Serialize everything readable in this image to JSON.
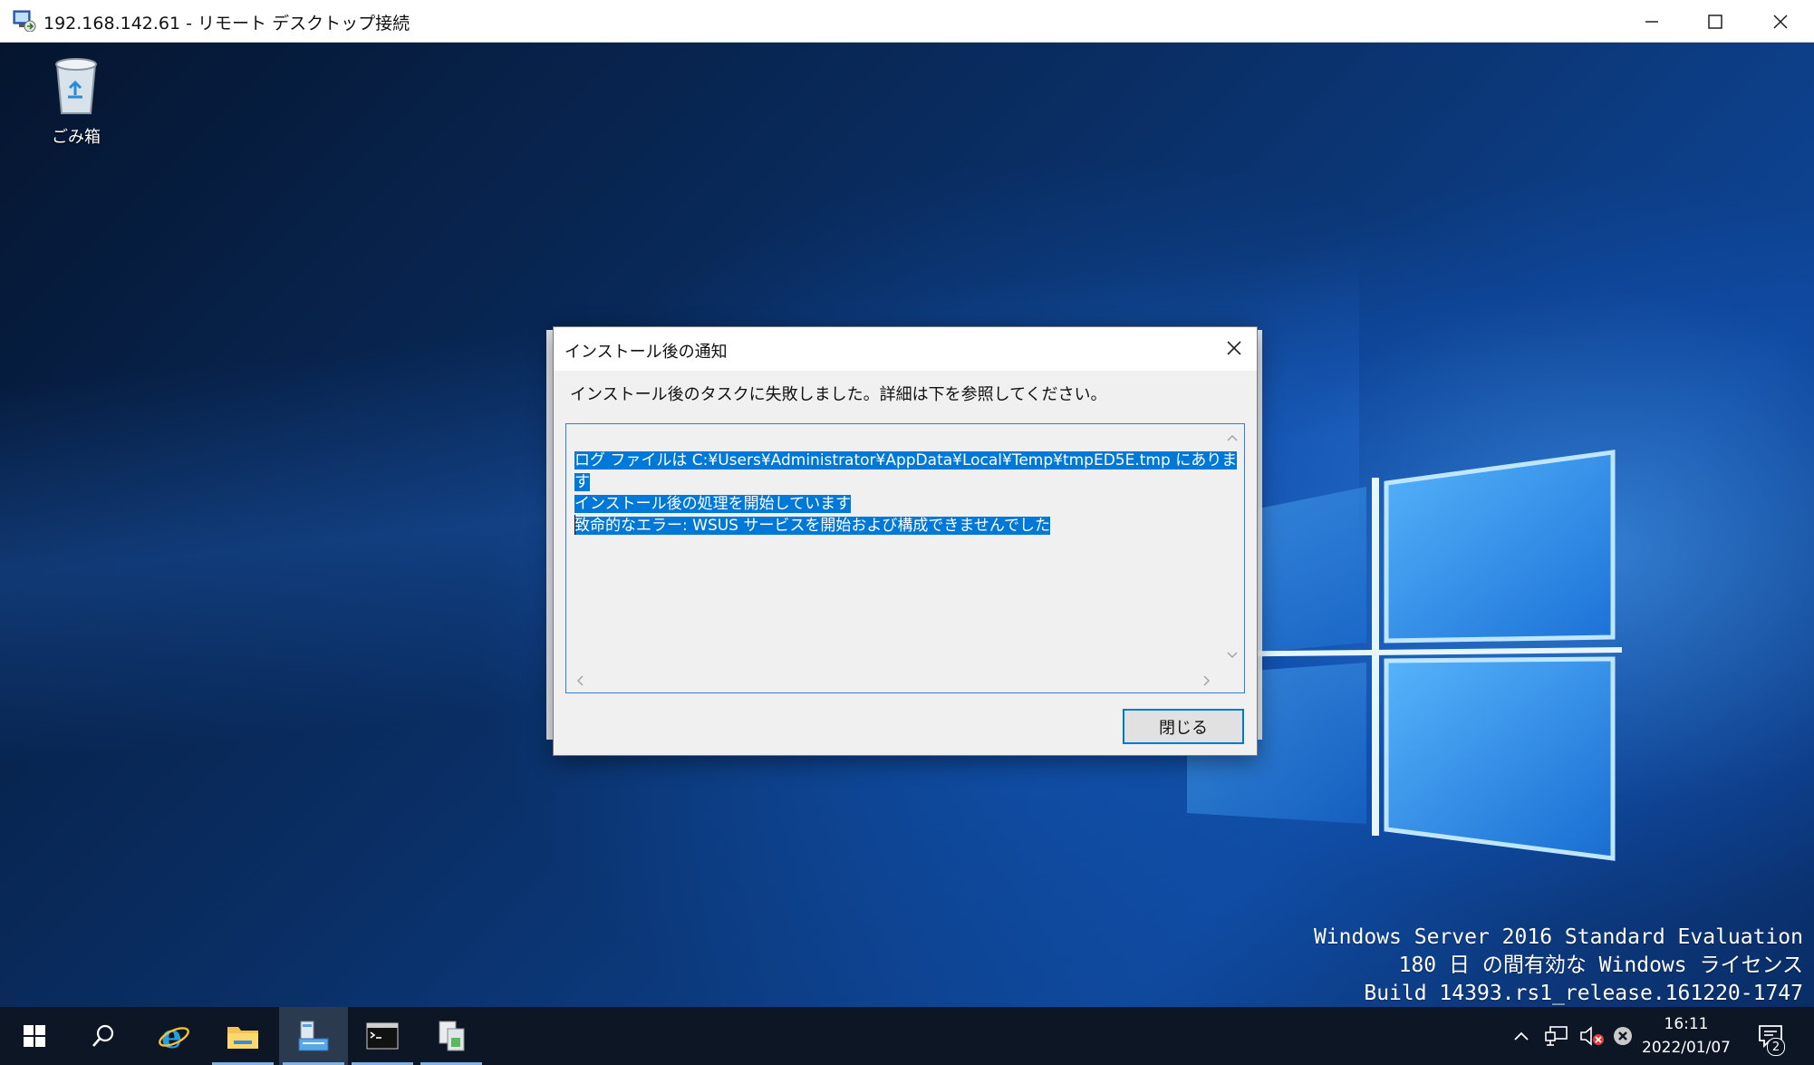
{
  "window": {
    "title": "192.168.142.61 - リモート デスクトップ接続",
    "controls": [
      "minimize",
      "maximize",
      "close"
    ]
  },
  "desktop": {
    "icons": [
      {
        "label": "ごみ箱",
        "icon": "recycle-bin-icon"
      }
    ],
    "watermark": {
      "line1": "Windows Server 2016 Standard Evaluation",
      "line2": "180 日 の間有効な Windows ライセンス",
      "line3": "Build 14393.rs1_release.161220-1747"
    }
  },
  "dialog": {
    "title": "インストール後の通知",
    "message": "インストール後のタスクに失敗しました。詳細は下を参照してください。",
    "log_lines": [
      "ログ ファイルは C:¥Users¥Administrator¥AppData¥Local¥Temp¥tmpED5E.tmp にあります",
      "インストール後の処理を開始しています",
      "致命的なエラー: WSUS サービスを開始および構成できませんでした"
    ],
    "close_button_label": "閉じる"
  },
  "taskbar": {
    "items": [
      {
        "name": "start",
        "icon": "windows-start-icon"
      },
      {
        "name": "search",
        "icon": "search-icon"
      },
      {
        "name": "internet-explorer",
        "icon": "internet-explorer-icon"
      },
      {
        "name": "file-explorer",
        "icon": "folder-icon"
      },
      {
        "name": "server-manager",
        "icon": "server-manager-icon",
        "active": true
      },
      {
        "name": "command-prompt",
        "icon": "cmd-icon"
      },
      {
        "name": "other-app",
        "icon": "app-icon"
      }
    ],
    "tray": {
      "icons": [
        "chevron-up-icon",
        "network-icon",
        "volume-muted-icon",
        "error-icon"
      ],
      "time": "16:11",
      "date": "2022/01/07",
      "notification_count": "2"
    }
  },
  "colors": {
    "selection": "#0078d7",
    "taskbar": "#0c1624",
    "dialog_bg": "#f0f0f0"
  }
}
